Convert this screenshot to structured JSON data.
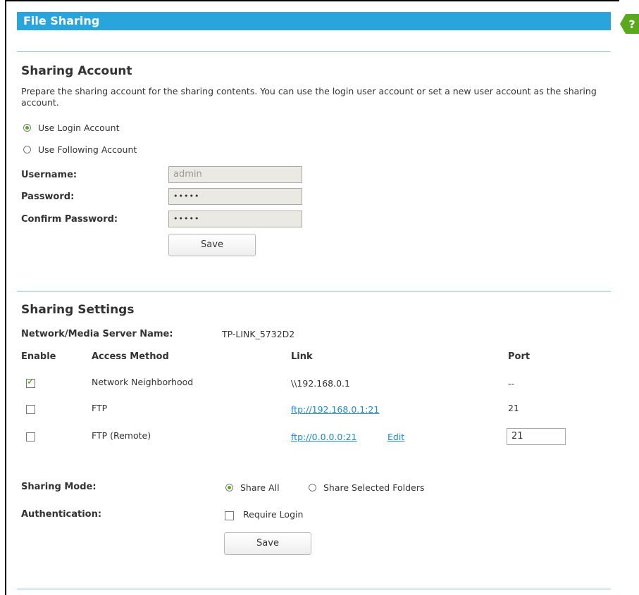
{
  "title": "File Sharing",
  "help_icon": "help-icon",
  "account": {
    "heading": "Sharing Account",
    "description": "Prepare the sharing account for the sharing contents. You can use the login user account or set a new user account as the sharing account.",
    "option_login": "Use Login Account",
    "option_following": "Use Following Account",
    "username_label": "Username:",
    "username_value": "admin",
    "password_label": "Password:",
    "password_value": "•••••",
    "confirm_label": "Confirm Password:",
    "confirm_value": "•••••",
    "save_label": "Save"
  },
  "settings": {
    "heading": "Sharing Settings",
    "server_label": "Network/Media Server Name:",
    "server_value": "TP-LINK_5732D2",
    "columns": [
      "Enable",
      "Access Method",
      "Link",
      "Port"
    ],
    "rows": [
      {
        "enabled": true,
        "method": "Network Neighborhood",
        "link": "\\\\192.168.0.1",
        "port": "--"
      },
      {
        "enabled": false,
        "method": "FTP",
        "link": "ftp://192.168.0.1:21",
        "port": "21"
      },
      {
        "enabled": false,
        "method": "FTP (Remote)",
        "link": "ftp://0.0.0.0:21",
        "edit": "Edit",
        "port": "21"
      }
    ],
    "mode_label": "Sharing Mode:",
    "mode_all": "Share All",
    "mode_selected": "Share Selected Folders",
    "auth_label": "Authentication:",
    "auth_option": "Require Login",
    "save_label": "Save"
  },
  "colors": {
    "accent": "#2aa4dd",
    "link": "#1a8bd0",
    "check": "#5aa81b"
  }
}
